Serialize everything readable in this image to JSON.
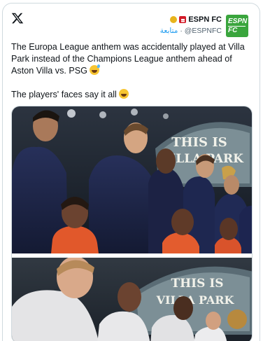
{
  "tweet": {
    "author_name": "ESPN FC",
    "follow_label": "متابعة",
    "handle": "@ESPNFC",
    "avatar_line1": "ESPN",
    "avatar_line2": "FC",
    "text_line1": "The Europa League anthem was accidentally played at Villa Park instead of the Champions League anthem ahead of Aston Villa vs. PSG",
    "text_line2": "The players' faces say it all",
    "emoji1": "grinning-face-with-sweat",
    "emoji2": "face-with-tears-of-joy"
  },
  "media": {
    "photo1_banner_line1": "THIS IS",
    "photo1_banner_line2": "VILLA PARK",
    "photo2_banner_line1": "THIS IS",
    "photo2_banner_line2": "VILLA PARK"
  },
  "colors": {
    "espn_green": "#3aa53d",
    "link_blue": "#1d9bf0",
    "villa_claret": "#6b1c3a"
  }
}
